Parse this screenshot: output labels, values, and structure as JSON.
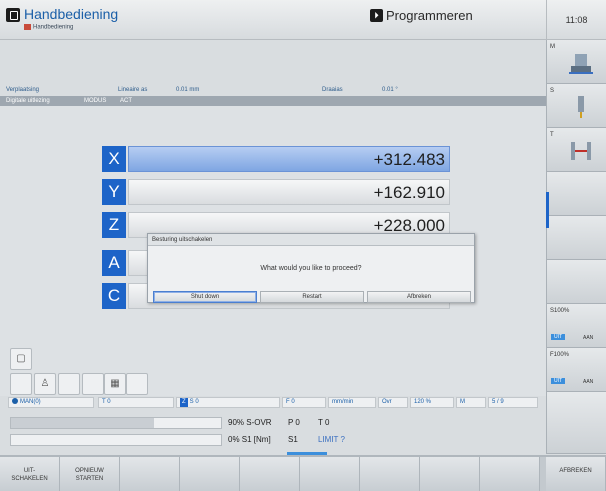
{
  "header": {
    "mode_title": "Handbediening",
    "mode_subtitle": "Handbediening",
    "program_title": "Programmeren",
    "clock": "11:08"
  },
  "info": {
    "verplaatsing": "Verplaatsing",
    "lineaire_as": "Lineaire as",
    "lineaire_val": "0.01 mm",
    "draaias": "Draaias",
    "draaias_val": "0.01 °",
    "digitale_uitlezing": "Digitale uitlezing",
    "modus": "MODUS",
    "act": "ACT"
  },
  "axes": [
    {
      "letter": "X",
      "value": "+312.483"
    },
    {
      "letter": "Y",
      "value": "+162.910"
    },
    {
      "letter": "Z",
      "value": "+228.000"
    },
    {
      "letter": "A",
      "value": ""
    },
    {
      "letter": "C",
      "value": ""
    }
  ],
  "dialog": {
    "title": "Besturing uitschakelen",
    "message": "What would you like to proceed?",
    "btn_shutdown": "Shut down",
    "btn_restart": "Restart",
    "btn_cancel": "Afbreken"
  },
  "status": {
    "mode": "MAN(0)",
    "t": "T  0",
    "z": "Z",
    "s": "S   0",
    "f": "F  0",
    "feed_unit": "mm/min",
    "ovr": "Ovr",
    "ovr_val": "120 %",
    "m": "M",
    "m_val": "5 / 9"
  },
  "override": {
    "s_ovr": "90% S-OVR",
    "p": "P 0",
    "t": "T 0",
    "s1": "0% S1  [Nm]",
    "s1b": "S1",
    "limit": "LIMIT ?",
    "bar1_fill": 0.68,
    "bar2_fill": 0
  },
  "softkeys_bottom": [
    {
      "label1": "UIT-",
      "label2": "SCHAKELEN"
    },
    {
      "label1": "OPNIEUW",
      "label2": "STARTEN"
    },
    {
      "label1": "",
      "label2": ""
    },
    {
      "label1": "",
      "label2": ""
    },
    {
      "label1": "",
      "label2": ""
    },
    {
      "label1": "",
      "label2": ""
    },
    {
      "label1": "",
      "label2": ""
    },
    {
      "label1": "",
      "label2": ""
    },
    {
      "label1": "",
      "label2": ""
    },
    {
      "label1": "AFBREKEN",
      "label2": ""
    }
  ],
  "softkeys_vertical": {
    "m": "M",
    "s": "S",
    "t": "T",
    "s100": "S100%",
    "f100": "F100%",
    "uit": "UIT",
    "aan": "AAN"
  }
}
